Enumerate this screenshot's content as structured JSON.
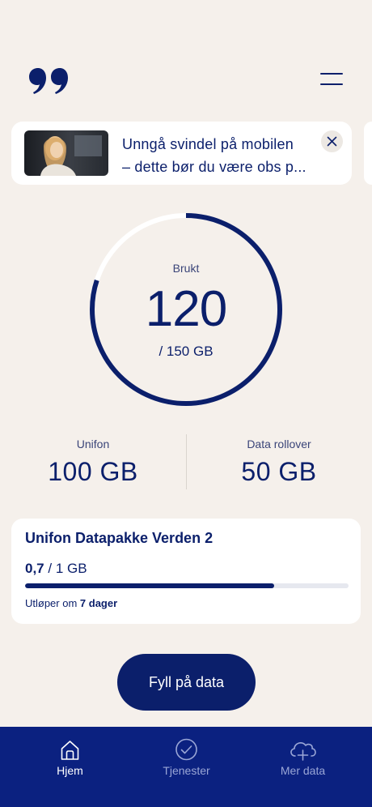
{
  "header": {
    "logo_icon": "quote-logo-icon",
    "menu_icon": "hamburger-menu-icon"
  },
  "promo": {
    "line1": "Unngå svindel på mobilen",
    "line2": "– dette bør du være obs p...",
    "close_icon": "close-icon"
  },
  "usage": {
    "label": "Brukt",
    "used": "120",
    "total_text": "/ 150 GB",
    "used_fraction": 0.8
  },
  "split": {
    "left_label": "Unifon",
    "left_value": "100 GB",
    "right_label": "Data rollover",
    "right_value": "50 GB"
  },
  "package": {
    "title": "Unifon Datapakke Verden 2",
    "used": "0,7",
    "total": "/ 1 GB",
    "used_fraction": 0.77,
    "expiry_prefix": "Utløper om",
    "expiry_value": "7 dager"
  },
  "cta": {
    "label": "Fyll på data"
  },
  "tabbar": {
    "tabs": [
      {
        "label": "Hjem",
        "icon": "home-icon",
        "active": true
      },
      {
        "label": "Tjenester",
        "icon": "check-circle-icon",
        "active": false
      },
      {
        "label": "Mer data",
        "icon": "cloud-plus-icon",
        "active": false
      }
    ]
  },
  "colors": {
    "brand": "#0b1f6b",
    "tabbar": "#0b2180",
    "background": "#f5f0eb"
  }
}
